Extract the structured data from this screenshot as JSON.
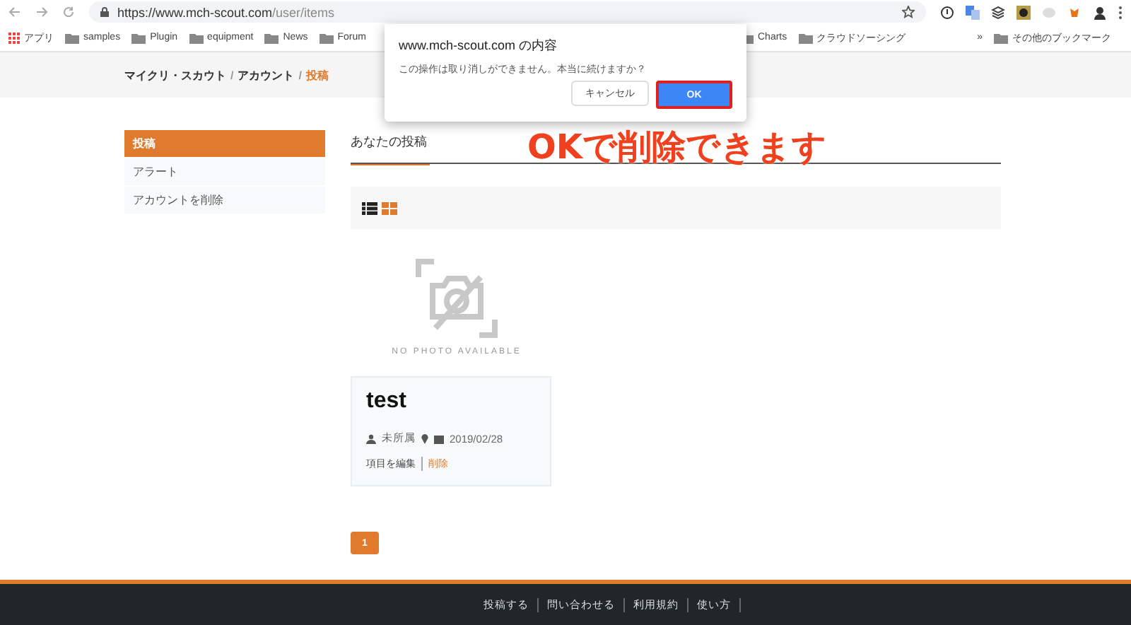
{
  "browser": {
    "url_host": "https://www.mch-scout.com",
    "url_path": "/user/items",
    "bookmarks": [
      {
        "label": "アプリ",
        "kind": "apps"
      },
      {
        "label": "samples",
        "kind": "folder"
      },
      {
        "label": "Plugin",
        "kind": "folder"
      },
      {
        "label": "equipment",
        "kind": "folder"
      },
      {
        "label": "News",
        "kind": "folder"
      },
      {
        "label": "Forum",
        "kind": "folder"
      }
    ],
    "bookmarks_right": [
      {
        "label": "Charts",
        "kind": "folder"
      },
      {
        "label": "クラウドソーシング",
        "kind": "folder"
      }
    ],
    "more": "»",
    "other_bookmarks": "その他のブックマーク"
  },
  "breadcrumb_separator": "/",
  "breadcrumb": [
    {
      "label": "マイクリ・スカウト",
      "selected": false
    },
    {
      "label": "アカウント",
      "selected": false
    },
    {
      "label": "投稿",
      "selected": true
    }
  ],
  "sidebar": [
    {
      "label": "投稿",
      "selected": true
    },
    {
      "label": "アラート",
      "selected": false
    },
    {
      "label": "アカウントを削除",
      "selected": false
    }
  ],
  "heading": "あなたの投稿",
  "view_toggle": [
    {
      "kind": "list",
      "selected": false
    },
    {
      "kind": "grid",
      "selected": true
    }
  ],
  "no_photo": "NO PHOTO AVAILABLE",
  "item": {
    "title": "test",
    "owner": "未所属",
    "date": "2019/02/28",
    "actions": [
      {
        "label": "項目を編集",
        "kind": "edit"
      },
      {
        "label": "削除",
        "kind": "delete"
      }
    ]
  },
  "pagination": [
    {
      "label": "1",
      "selected": true
    }
  ],
  "footer": [
    "投稿する",
    "問い合わせる",
    "利用規約",
    "使い方"
  ],
  "dialog": {
    "title": "www.mch-scout.com の内容",
    "message": "この操作は取り消しができません。本当に続けますか？",
    "cancel": "キャンセル",
    "ok": "OK"
  },
  "annotation": "OKで削除できます"
}
